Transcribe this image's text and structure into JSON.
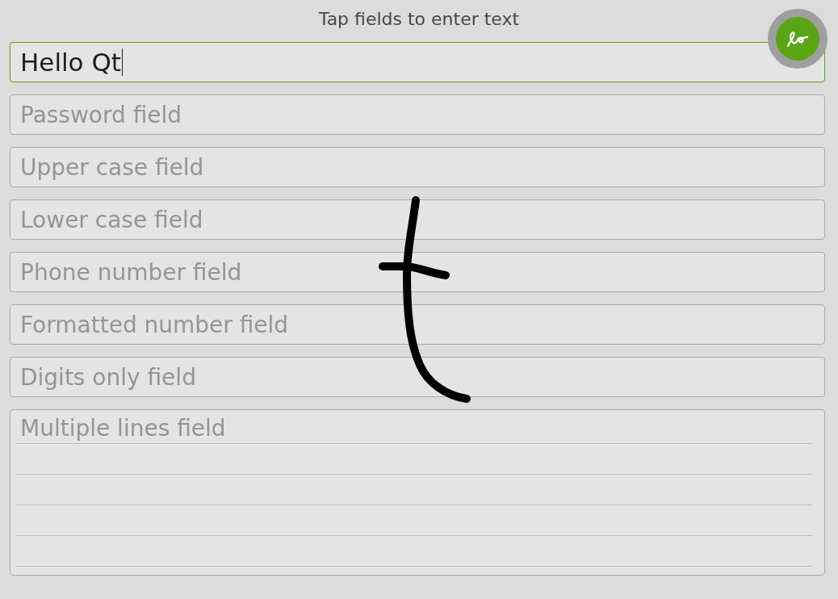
{
  "header": {
    "title": "Tap fields to enter text"
  },
  "fields": [
    {
      "kind": "line",
      "value": "Hello Qt",
      "focused": true
    },
    {
      "kind": "line",
      "placeholder": "Password field",
      "focused": false
    },
    {
      "kind": "line",
      "placeholder": "Upper case field",
      "focused": false
    },
    {
      "kind": "line",
      "placeholder": "Lower case field",
      "focused": false
    },
    {
      "kind": "line",
      "placeholder": "Phone number field",
      "focused": false
    },
    {
      "kind": "line",
      "placeholder": "Formatted number field",
      "focused": false
    },
    {
      "kind": "line",
      "placeholder": "Digits only field",
      "focused": false
    },
    {
      "kind": "multiline",
      "placeholder": "Multiple lines field",
      "focused": false
    }
  ],
  "handwriting_button": {
    "on": true
  }
}
